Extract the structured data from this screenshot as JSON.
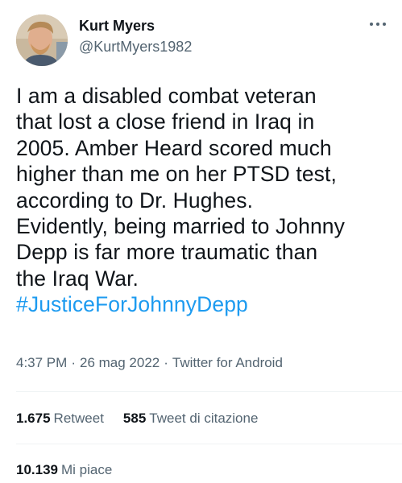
{
  "author": {
    "display_name": "Kurt Myers",
    "handle": "@KurtMyers1982"
  },
  "icons": {
    "more": "more-horizontal-icon",
    "avatar": "profile-photo"
  },
  "tweet": {
    "text": "I am a disabled combat veteran\nthat lost a close friend in Iraq in\n2005. Amber Heard scored much\nhigher than me on her PTSD test,\naccording to Dr. Hughes.\nEvidently, being married to Johnny\nDepp is far more traumatic than\nthe Iraq War.\n",
    "hashtag": "#JusticeForJohnnyDepp"
  },
  "meta": {
    "time": "4:37 PM",
    "date": "26 mag 2022",
    "source": "Twitter for Android",
    "separator": "·"
  },
  "stats": {
    "retweets_count": "1.675",
    "retweets_label": "Retweet",
    "quotes_count": "585",
    "quotes_label": "Tweet di citazione",
    "likes_count": "10.139",
    "likes_label": "Mi piace"
  },
  "colors": {
    "link": "#1d9bf0",
    "secondary_text": "#536471",
    "divider": "#eff3f4"
  }
}
